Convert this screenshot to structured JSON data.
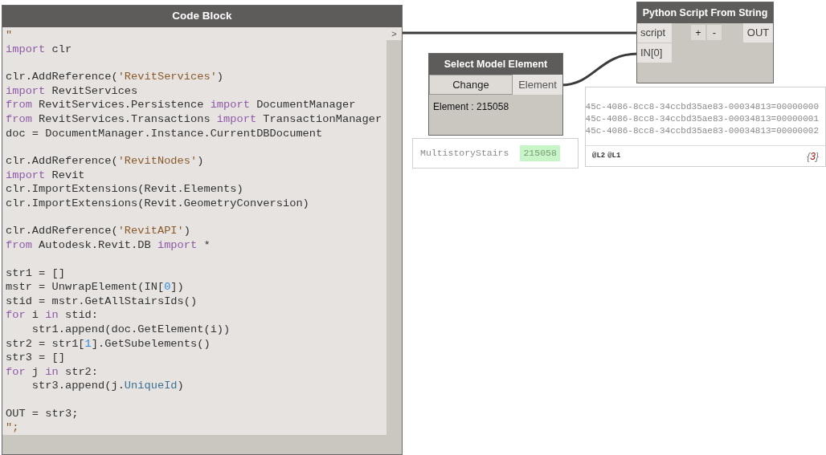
{
  "code_block": {
    "title": "Code Block",
    "output_port": ">",
    "lines": [
      {
        "tokens": [
          {
            "text": "\"",
            "kind": "string"
          }
        ]
      },
      {
        "tokens": [
          {
            "text": "import",
            "kind": "keyword"
          },
          {
            "text": " clr",
            "kind": "plain"
          }
        ]
      },
      {
        "kind": "blank"
      },
      {
        "tokens": [
          {
            "text": "clr.AddReference(",
            "kind": "plain"
          },
          {
            "text": "'RevitServices'",
            "kind": "string"
          },
          {
            "text": ")",
            "kind": "plain"
          }
        ]
      },
      {
        "tokens": [
          {
            "text": "import",
            "kind": "keyword"
          },
          {
            "text": " RevitServices",
            "kind": "plain"
          }
        ]
      },
      {
        "tokens": [
          {
            "text": "from",
            "kind": "keyword"
          },
          {
            "text": " RevitServices.Persistence ",
            "kind": "plain"
          },
          {
            "text": "import",
            "kind": "keyword"
          },
          {
            "text": " DocumentManager",
            "kind": "plain"
          }
        ]
      },
      {
        "tokens": [
          {
            "text": "from",
            "kind": "keyword"
          },
          {
            "text": " RevitServices.Transactions ",
            "kind": "plain"
          },
          {
            "text": "import",
            "kind": "keyword"
          },
          {
            "text": " TransactionManager",
            "kind": "plain"
          }
        ]
      },
      {
        "tokens": [
          {
            "text": "doc = DocumentManager.Instance.CurrentDBDocument",
            "kind": "plain"
          }
        ]
      },
      {
        "kind": "blank"
      },
      {
        "tokens": [
          {
            "text": "clr.AddReference(",
            "kind": "plain"
          },
          {
            "text": "'RevitNodes'",
            "kind": "string"
          },
          {
            "text": ")",
            "kind": "plain"
          }
        ]
      },
      {
        "tokens": [
          {
            "text": "import",
            "kind": "keyword"
          },
          {
            "text": " Revit",
            "kind": "plain"
          }
        ]
      },
      {
        "tokens": [
          {
            "text": "clr.ImportExtensions(Revit.Elements)",
            "kind": "plain"
          }
        ]
      },
      {
        "tokens": [
          {
            "text": "clr.ImportExtensions(Revit.GeometryConversion)",
            "kind": "plain"
          }
        ]
      },
      {
        "kind": "blank"
      },
      {
        "tokens": [
          {
            "text": "clr.AddReference(",
            "kind": "plain"
          },
          {
            "text": "'RevitAPI'",
            "kind": "string"
          },
          {
            "text": ")",
            "kind": "plain"
          }
        ]
      },
      {
        "tokens": [
          {
            "text": "from",
            "kind": "keyword"
          },
          {
            "text": " Autodesk.Revit.DB ",
            "kind": "plain"
          },
          {
            "text": "import",
            "kind": "keyword"
          },
          {
            "text": " *",
            "kind": "plain"
          }
        ]
      },
      {
        "kind": "blank"
      },
      {
        "tokens": [
          {
            "text": "str1 = []",
            "kind": "plain"
          }
        ]
      },
      {
        "tokens": [
          {
            "text": "mstr = UnwrapElement(IN[",
            "kind": "plain"
          },
          {
            "text": "0",
            "kind": "number"
          },
          {
            "text": "])",
            "kind": "plain"
          }
        ]
      },
      {
        "tokens": [
          {
            "text": "stid = mstr.GetAllStairsIds()",
            "kind": "plain"
          }
        ]
      },
      {
        "tokens": [
          {
            "text": "for",
            "kind": "keyword"
          },
          {
            "text": " i ",
            "kind": "plain"
          },
          {
            "text": "in",
            "kind": "keyword"
          },
          {
            "text": " stid:",
            "kind": "plain"
          }
        ]
      },
      {
        "tokens": [
          {
            "text": "    str1.append(doc.GetElement(i))",
            "kind": "plain"
          }
        ]
      },
      {
        "tokens": [
          {
            "text": "str2 = str1[",
            "kind": "plain"
          },
          {
            "text": "1",
            "kind": "number"
          },
          {
            "text": "].GetSubelements()",
            "kind": "plain"
          }
        ]
      },
      {
        "tokens": [
          {
            "text": "str3 = []",
            "kind": "plain"
          }
        ]
      },
      {
        "tokens": [
          {
            "text": "for",
            "kind": "keyword"
          },
          {
            "text": " j ",
            "kind": "plain"
          },
          {
            "text": "in",
            "kind": "keyword"
          },
          {
            "text": " str2:",
            "kind": "plain"
          }
        ]
      },
      {
        "tokens": [
          {
            "text": "    str3.append(j.",
            "kind": "plain"
          },
          {
            "text": "UniqueId",
            "kind": "attribute"
          },
          {
            "text": ")",
            "kind": "plain"
          }
        ]
      },
      {
        "kind": "blank"
      },
      {
        "tokens": [
          {
            "text": "OUT = str3;",
            "kind": "plain"
          }
        ]
      },
      {
        "tokens": [
          {
            "text": "\";",
            "kind": "string"
          }
        ]
      }
    ]
  },
  "select_node": {
    "title": "Select Model Element",
    "button": "Change",
    "output_port": "Element",
    "info": "Element : 215058",
    "preview": {
      "label": "MultistoryStairs",
      "value": "215058"
    }
  },
  "python_node": {
    "title": "Python Script From String",
    "input_ports": [
      "script",
      "IN[0]"
    ],
    "buttons": [
      "+",
      "-"
    ],
    "output_port": "OUT",
    "preview": {
      "items": [
        "45c-4086-8cc8-34ccbd35ae83-00034813=00000000",
        "45c-4086-8cc8-34ccbd35ae83-00034813=00000001",
        "45c-4086-8cc8-34ccbd35ae83-00034813=00000002"
      ],
      "levels": [
        "@L2",
        "@L1"
      ],
      "count": {
        "open": "{",
        "value": "3",
        "close": "}"
      }
    }
  }
}
